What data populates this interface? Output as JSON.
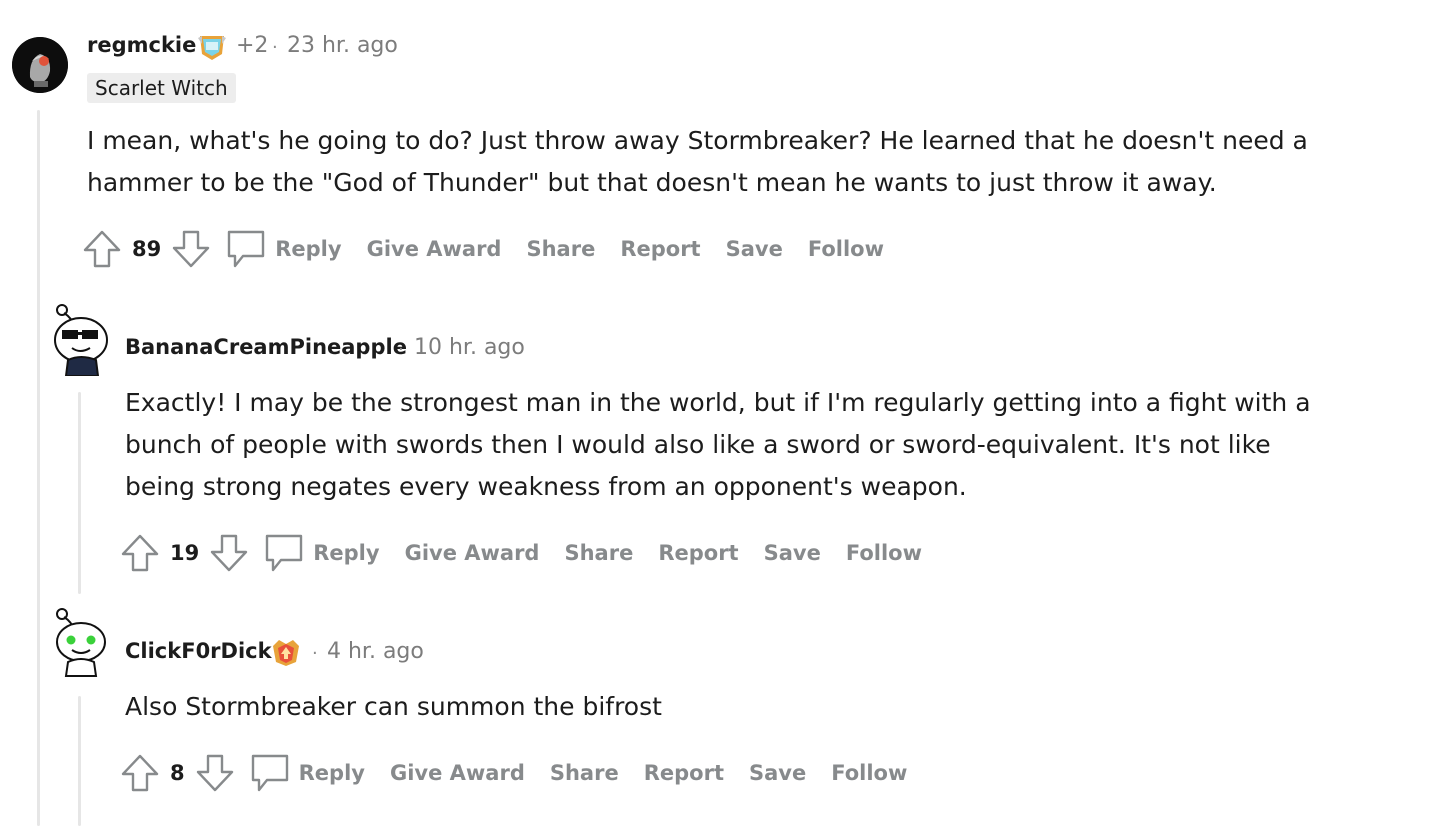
{
  "comments": [
    {
      "author": "regmckie",
      "award_extra": "+2",
      "separator": "·",
      "time": "23 hr. ago",
      "flair": "Scarlet Witch",
      "body_lines": [
        "I mean, what's he going to do? Just throw away Stormbreaker? He learned that he doesn't need a",
        "hammer to be the \"God of Thunder\" but that doesn't mean he wants to just throw it away."
      ],
      "score": "89"
    },
    {
      "author": "BananaCreamPineapple",
      "separator": "·",
      "time": "10 hr. ago",
      "body_lines": [
        "Exactly! I may be the strongest man in the world, but if I'm regularly getting into a fight with a",
        "bunch of people with swords then I would also like a sword or sword-equivalent. It's not like",
        "being strong negates every weakness from an opponent's weapon."
      ],
      "score": "19"
    },
    {
      "author": "ClickF0rDick",
      "separator": "·",
      "time": "4 hr. ago",
      "body_lines": [
        "Also Stormbreaker can summon the bifrost"
      ],
      "score": "8"
    }
  ],
  "actions": {
    "reply": "Reply",
    "give_award": "Give Award",
    "share": "Share",
    "report": "Report",
    "save": "Save",
    "follow": "Follow"
  },
  "colors": {
    "action_gray": "#878a8c",
    "meta_gray": "#7c7c7c",
    "thread_line": "#e6e6e6",
    "flair_bg": "#ededed"
  },
  "icons": [
    "upvote-icon",
    "downvote-icon",
    "reply-bubble-icon",
    "award-icon",
    "snoo-avatar-icon"
  ]
}
